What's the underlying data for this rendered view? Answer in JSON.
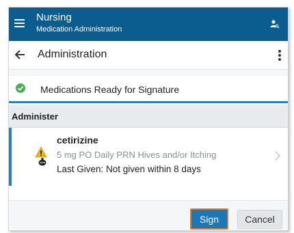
{
  "appbar": {
    "title": "Nursing",
    "subtitle": "Medication Administration",
    "menu_icon": "hamburger-menu-icon",
    "user_icon": "user-search-icon"
  },
  "header": {
    "title": "Administration",
    "back_icon": "arrow-left-icon",
    "more_icon": "more-vertical-icon"
  },
  "status": {
    "icon": "check-circle-icon",
    "text": "Medications Ready for Signature"
  },
  "section": {
    "title": "Administer"
  },
  "medication": {
    "name": "cetirizine",
    "dose": "5 mg PO Daily PRN Hives and/or Itching",
    "last_given": "Last Given: Not given within 8 days",
    "warning_icon": "warning-triangle-icon",
    "pill_icon": "pill-icon",
    "chevron_icon": "chevron-right-icon"
  },
  "footer": {
    "sign_label": "Sign",
    "cancel_label": "Cancel"
  },
  "colors": {
    "appbar": "#0b5d8f",
    "accent": "#2a7fb5",
    "sign_button": "#1a78b8",
    "sign_border": "#e07b2c",
    "success": "#4caf50",
    "warning": "#f2b705"
  }
}
